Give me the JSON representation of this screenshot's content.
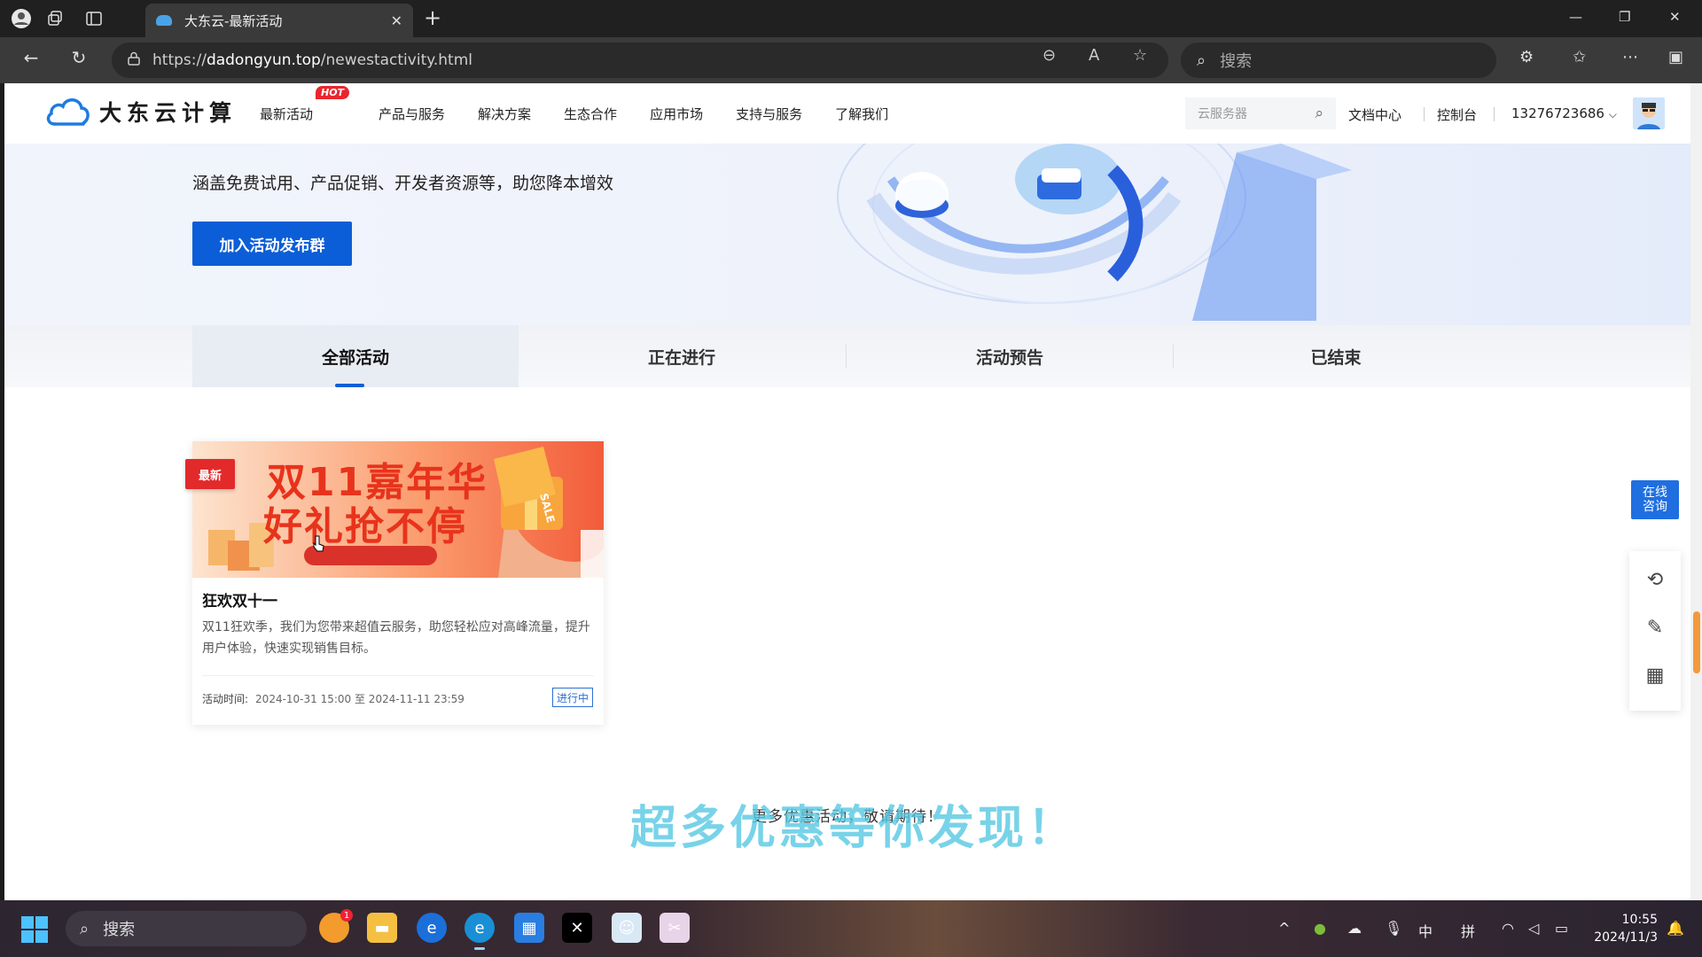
{
  "browser": {
    "tab_title": "大东云-最新活动",
    "url_prefix": "https://",
    "url_host": "dadongyun.top",
    "url_path": "/newestactivity.html",
    "search_placeholder": "搜索"
  },
  "site": {
    "logo_text": "大东云计算",
    "nav": [
      "最新活动",
      "产品与服务",
      "解决方案",
      "生态合作",
      "应用市场",
      "支持与服务",
      "了解我们"
    ],
    "hot_badge": "HOT",
    "search_placeholder": "云服务器",
    "docs": "文档中心",
    "console": "控制台",
    "account": "13276723686"
  },
  "hero": {
    "subtitle": "涵盖免费试用、产品促销、开发者资源等，助您降本增效",
    "join_button": "加入活动发布群"
  },
  "filter_tabs": [
    "全部活动",
    "正在进行",
    "活动预告",
    "已结束"
  ],
  "active_tab": "全部活动",
  "activity": {
    "badge": "最新",
    "banner_line1": "双11嘉年华",
    "banner_line2": "好礼抢不停",
    "banner_tag": "SALE",
    "title": "狂欢双十一",
    "description": "双11狂欢季，我们为您带来超值云服务，助您轻松应对高峰流量，提升用户体验，快速实现销售目标。",
    "time_label": "活动时间:",
    "time_range": "2024-10-31 15:00 至 2024-11-11 23:59",
    "status": "进行中"
  },
  "footer_note": "更多优惠活动，敬请期待！",
  "overlay_caption": "超多优惠等你发现！",
  "sidebar": {
    "consult_label": "在线咨询"
  },
  "taskbar": {
    "search_placeholder": "搜索",
    "ime_lang": "中",
    "ime_mode": "拼",
    "time": "10:55",
    "date": "2024/11/3",
    "notification_count": "1"
  },
  "colors": {
    "brand_blue": "#0b5ed7",
    "hot_red": "#e8262f",
    "overlay_cyan": "#56c8e2"
  }
}
